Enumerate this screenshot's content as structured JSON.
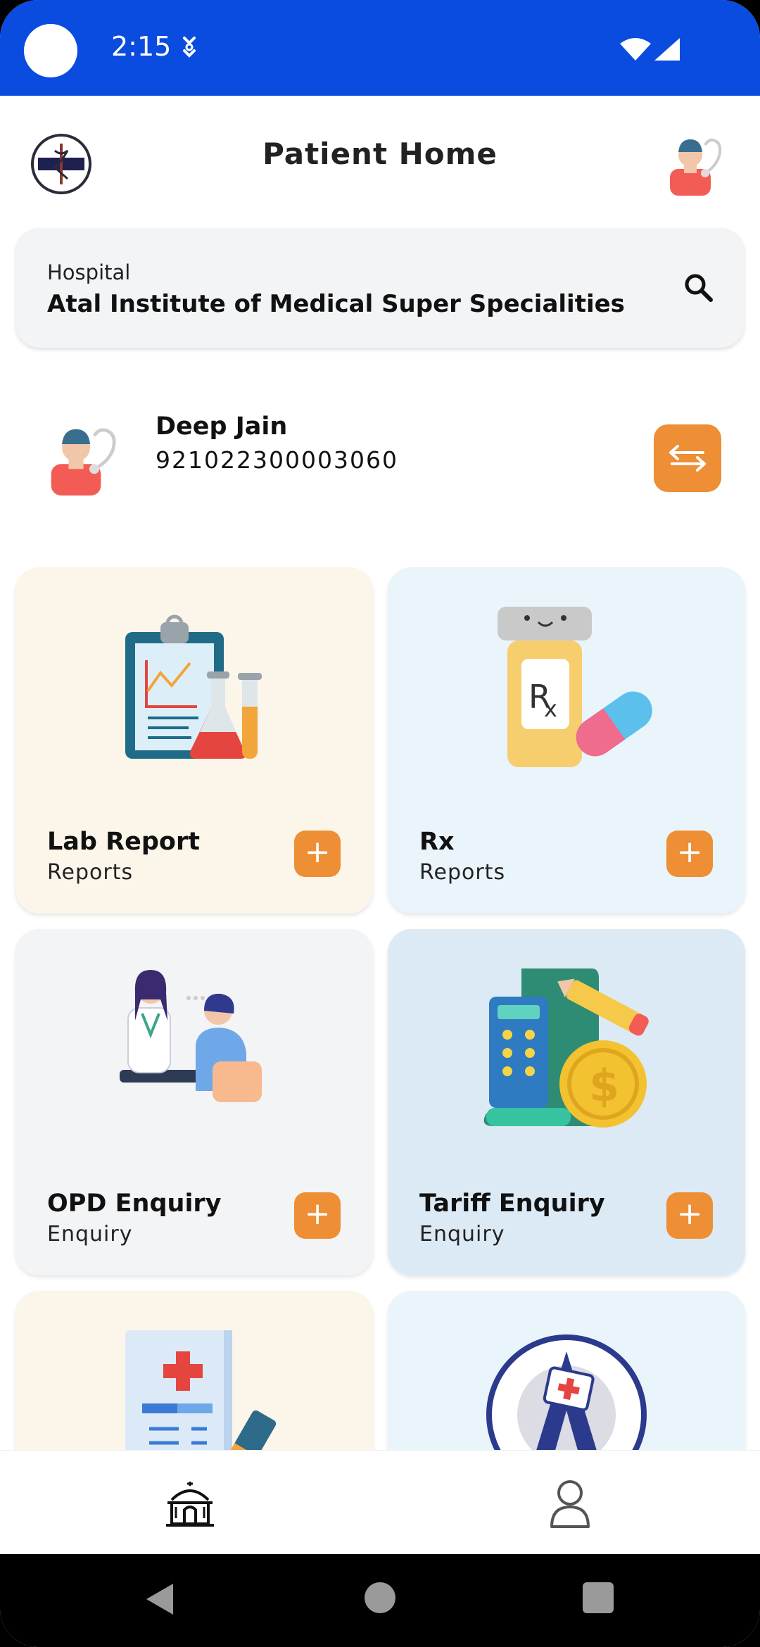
{
  "status_bar": {
    "time": "2:15"
  },
  "header": {
    "title": "Patient Home"
  },
  "hospital": {
    "label": "Hospital",
    "name": "Atal Institute of Medical Super Specialities"
  },
  "patient": {
    "name": "Deep Jain",
    "id": "921022300003060"
  },
  "tiles": [
    {
      "title": "Lab Report",
      "subtitle": "Reports",
      "bg": "#FBF5EA"
    },
    {
      "title": "Rx",
      "subtitle": "Reports",
      "bg": "#EAF4FB"
    },
    {
      "title": "OPD Enquiry",
      "subtitle": "Enquiry",
      "bg": "#F3F4F6"
    },
    {
      "title": "Tariff Enquiry",
      "subtitle": "Enquiry",
      "bg": "#DCEAF5"
    },
    {
      "title": "",
      "subtitle": "",
      "bg": "#FBF5EA"
    },
    {
      "title": "",
      "subtitle": "",
      "bg": "#EAF4FB"
    }
  ],
  "colors": {
    "status_bar": "#0A4BE0",
    "accent": "#EE8E35"
  },
  "icons": {
    "search": "search-icon",
    "switch": "swap-arrows-icon",
    "nav_home": "home-icon",
    "nav_profile": "person-icon"
  }
}
